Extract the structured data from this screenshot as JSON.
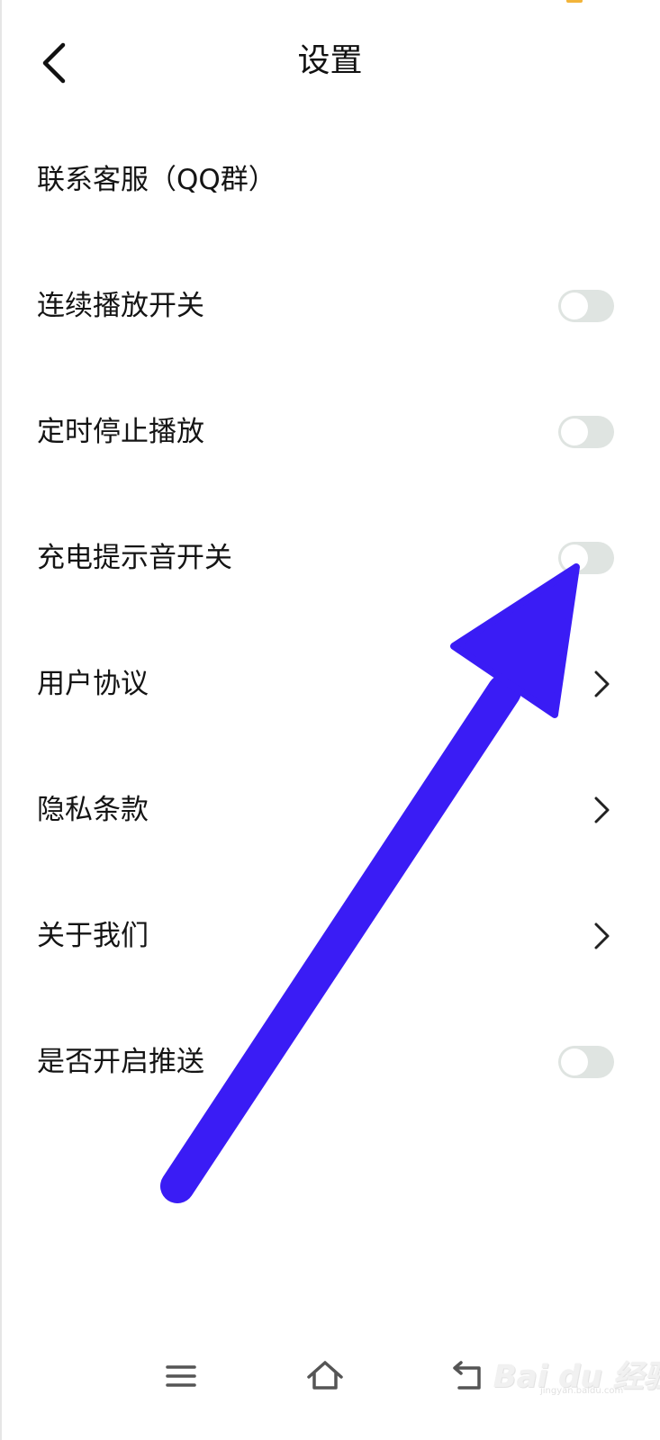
{
  "header": {
    "title": "设置"
  },
  "settings": {
    "items": [
      {
        "label": "联系客服（QQ群）",
        "control": "none"
      },
      {
        "label": "连续播放开关",
        "control": "toggle",
        "on": false
      },
      {
        "label": "定时停止播放",
        "control": "toggle",
        "on": false
      },
      {
        "label": "充电提示音开关",
        "control": "toggle",
        "on": false
      },
      {
        "label": "用户协议",
        "control": "chevron"
      },
      {
        "label": "隐私条款",
        "control": "chevron"
      },
      {
        "label": "关于我们",
        "control": "chevron"
      },
      {
        "label": "是否开启推送",
        "control": "toggle",
        "on": false
      }
    ]
  },
  "annotation": {
    "arrow_color": "#3a1cf5",
    "points_to": "充电提示音开关 toggle"
  },
  "nav": {
    "icons": [
      "menu-icon",
      "home-icon",
      "back-icon"
    ]
  },
  "watermark": {
    "logo": "Bai du 经验",
    "url": "jingyan.baidu.com"
  },
  "colors": {
    "toggle_off_track": "#dfe4e1",
    "toggle_knob": "#ffffff",
    "status_mark": "#f2b43a"
  }
}
